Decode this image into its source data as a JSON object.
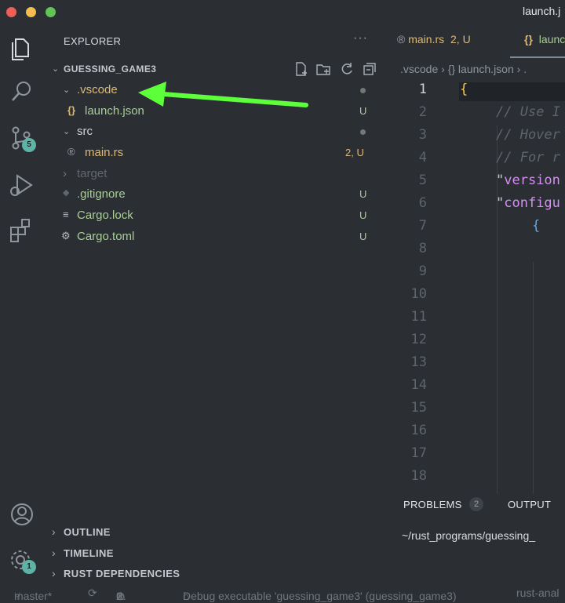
{
  "window": {
    "title": "launch.j"
  },
  "activity_bar": {
    "items": [
      {
        "icon": "explorer-icon"
      },
      {
        "icon": "search-icon"
      },
      {
        "icon": "source-control-icon",
        "badge": "5"
      },
      {
        "icon": "run-debug-icon"
      },
      {
        "icon": "extensions-icon"
      }
    ],
    "bottom": [
      {
        "icon": "account-icon"
      },
      {
        "icon": "manage-gear-icon",
        "badge": "1"
      }
    ]
  },
  "sidebar": {
    "title": "EXPLORER",
    "more": "···",
    "root": "GUESSING_GAME3",
    "tree": [
      {
        "name": ".vscode",
        "status": "",
        "icon": "▾"
      },
      {
        "name": "launch.json",
        "status": "U",
        "icon": "{}"
      },
      {
        "name": "src",
        "status": "",
        "icon": "▾"
      },
      {
        "name": "main.rs",
        "status": "2, U",
        "icon": "®"
      },
      {
        "name": "target",
        "status": "",
        "icon": "›"
      },
      {
        "name": ".gitignore",
        "status": "U",
        "icon": "◆"
      },
      {
        "name": "Cargo.lock",
        "status": "U",
        "icon": "≡"
      },
      {
        "name": "Cargo.toml",
        "status": "U",
        "icon": "⚙"
      }
    ],
    "sections": [
      "OUTLINE",
      "TIMELINE",
      "RUST DEPENDENCIES"
    ]
  },
  "editor": {
    "tabs": [
      {
        "label": "main.rs",
        "status": "2, U",
        "icon": "®"
      },
      {
        "label": "launc",
        "icon": "{}"
      }
    ],
    "breadcrumb": ".vscode  ›  {} launch.json  ›  .",
    "line_numbers": [
      "1",
      "2",
      "3",
      "4",
      "5",
      "6",
      "7",
      "8",
      "9",
      "10",
      "11",
      "12",
      "13",
      "14",
      "15",
      "16",
      "17",
      "18"
    ],
    "code": {
      "l1": "{",
      "l2": "// Use I",
      "l3": "// Hover",
      "l4": "// For r",
      "l5_q": "\"",
      "l5_k": "version",
      "l6_q": "\"",
      "l6_k": "configu",
      "l7": "{"
    }
  },
  "panel": {
    "tabs": [
      "PROBLEMS",
      "OUTPUT"
    ],
    "problems_count": "2",
    "terminal_text": "~/rust_programs/guessing_"
  },
  "statusbar": {
    "branch": "master*",
    "errors": "0",
    "warnings": "2",
    "debug": "Debug executable 'guessing_game3' (guessing_game3)",
    "rust": "rust-anal"
  },
  "colors": {
    "bg": "#2b2f34",
    "modified": "#e2c08d",
    "untracked": "#73c991",
    "arrow": "#5dff3a"
  }
}
